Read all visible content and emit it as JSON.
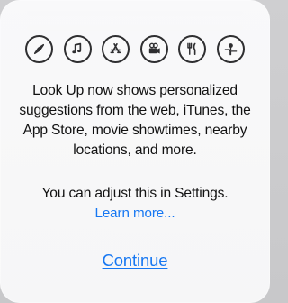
{
  "dialog": {
    "icons": [
      {
        "name": "compass-icon"
      },
      {
        "name": "music-note-icon"
      },
      {
        "name": "app-store-icon"
      },
      {
        "name": "movie-camera-icon"
      },
      {
        "name": "restaurant-icon"
      },
      {
        "name": "location-map-icon"
      }
    ],
    "message": "Look Up now shows personalized suggestions from the web, iTunes, the App Store, movie showtimes, nearby locations, and more.",
    "settings_note": "You can adjust this in Settings.",
    "learn_more_label": "Learn more...",
    "continue_label": "Continue"
  },
  "colors": {
    "accent": "#1677f2",
    "text": "#111111",
    "icon_stroke": "#2f2f31",
    "sheet_background": "#f8f8f9",
    "backdrop": "#cfcfd1"
  }
}
